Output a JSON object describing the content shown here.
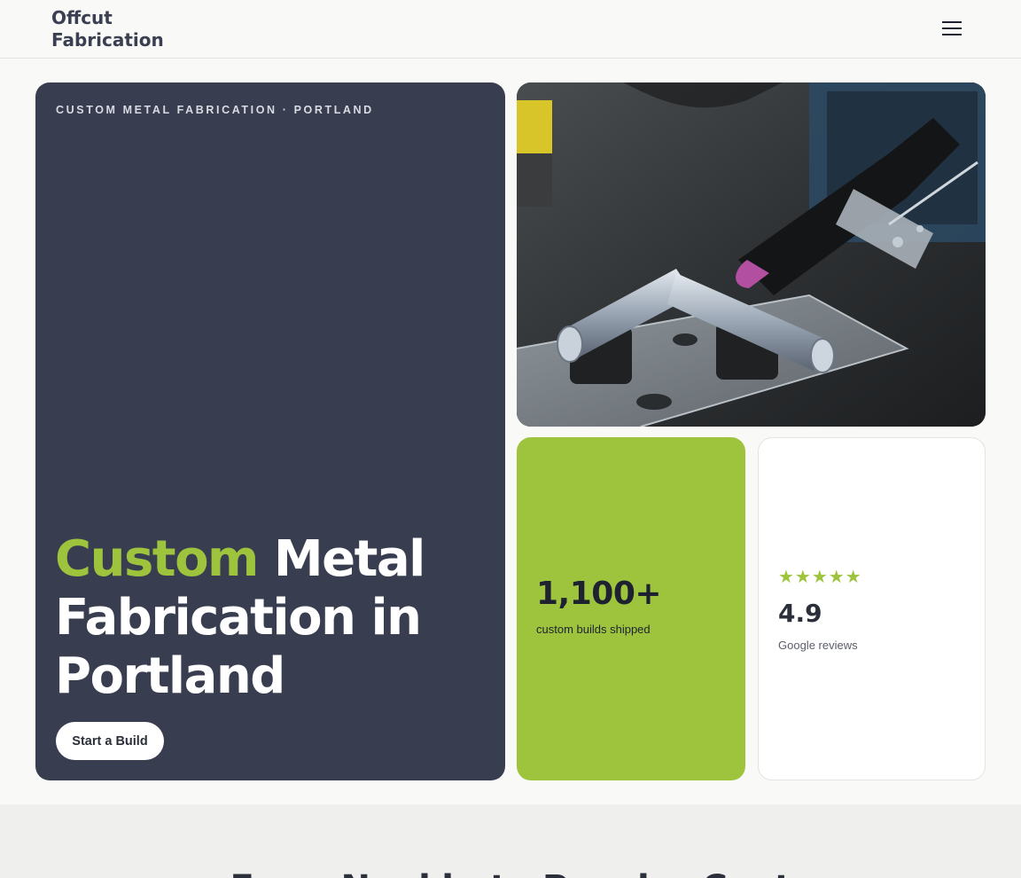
{
  "header": {
    "logo_line1": "Offcut",
    "logo_line2": "Fabrication",
    "menu_icon": "hamburger-menu-icon"
  },
  "hero": {
    "eyebrow": "CUSTOM METAL FABRICATION · PORTLAND",
    "headline_accent": "Custom",
    "headline_rest": " Metal Fabrication in Portland",
    "cta_label": "Start a Build"
  },
  "stats": {
    "builds_value": "1,100+",
    "builds_label": "custom builds shipped"
  },
  "reviews": {
    "stars": "★★★★★",
    "rating": "4.9",
    "label": "Google reviews"
  },
  "section2": {
    "title": "From Napkin to Powder Coat"
  },
  "colors": {
    "accent": "#9dc43c",
    "dark_card": "#393d50",
    "background": "#f9f9f7"
  }
}
